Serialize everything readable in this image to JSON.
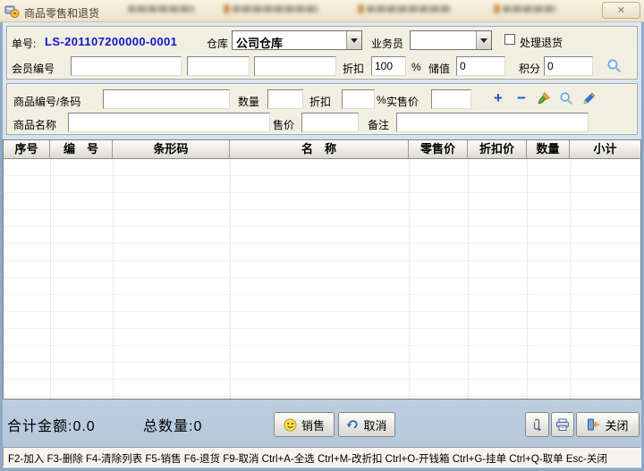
{
  "window": {
    "title": "商品零售和退货",
    "close_glyph": "✕"
  },
  "header_panel": {
    "order_label": "单号:",
    "order_value": "LS-201107200000-0001",
    "warehouse_label": "仓库",
    "warehouse_value": "公司仓库",
    "clerk_label": "业务员",
    "clerk_value": "",
    "return_check_label": "处理退货",
    "member_label": "会员编号",
    "member_inputs": [
      "",
      "",
      ""
    ],
    "discount_label": "折扣",
    "discount_value": "100",
    "percent_sign": "%",
    "stored_label": "储值",
    "stored_value": "0",
    "points_label": "积分",
    "points_value": "0"
  },
  "entry_panel": {
    "code_label": "商品编号/条码",
    "code_value": "",
    "qty_label": "数量",
    "qty_value": "",
    "discount_label": "折扣",
    "discount_value": "",
    "percent_sign": "%",
    "actual_price_label": "实售价",
    "actual_price_value": "",
    "name_label": "商品名称",
    "name_value": "",
    "price_label": "售价",
    "price_value": "",
    "remark_label": "备注",
    "remark_value": ""
  },
  "icons": {
    "plus": "+",
    "minus": "−"
  },
  "table": {
    "columns": [
      "序号",
      "编　号",
      "条形码",
      "名　称",
      "零售价",
      "折扣价",
      "数量",
      "小计"
    ],
    "rows": []
  },
  "footer": {
    "total_amount_label": "合计金额:",
    "total_amount_value": "0.0",
    "total_qty_label": "总数量:",
    "total_qty_value": "0",
    "sale_button_label": "销售",
    "cancel_button_label": "取消",
    "close_button_label": "关闭"
  },
  "status_bar": {
    "text": "F2-加入 F3-删除 F4-清除列表 F5-销售 F6-退货 F9-取消 Ctrl+A-全选 Ctrl+M-改折扣  Ctrl+O-开钱箱 Ctrl+G-挂单 Ctrl+Q-取单 Esc-关闭"
  }
}
